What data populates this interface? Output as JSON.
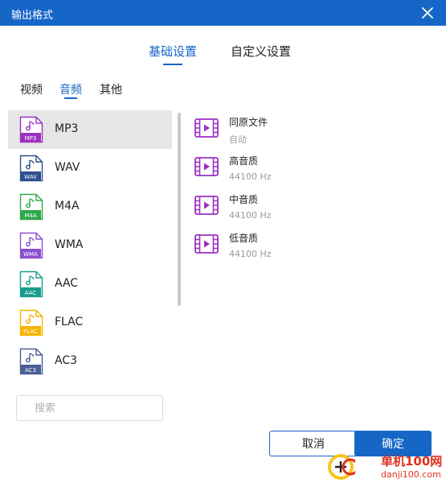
{
  "window": {
    "title": "输出格式"
  },
  "top_tabs": [
    {
      "label": "基础设置",
      "active": true
    },
    {
      "label": "自定义设置",
      "active": false
    }
  ],
  "sub_tabs": [
    {
      "label": "视频",
      "active": false
    },
    {
      "label": "音频",
      "active": true
    },
    {
      "label": "其他",
      "active": false
    }
  ],
  "formats": [
    {
      "label": "MP3",
      "tag": "MP3",
      "color": "#9b30c0",
      "selected": true
    },
    {
      "label": "WAV",
      "tag": "WAV",
      "color": "#2f4f8f",
      "selected": false
    },
    {
      "label": "M4A",
      "tag": "M4A",
      "color": "#2fa84a",
      "selected": false
    },
    {
      "label": "WMA",
      "tag": "WMA",
      "color": "#8a4fd0",
      "selected": false
    },
    {
      "label": "AAC",
      "tag": "AAC",
      "color": "#1a9c8c",
      "selected": false
    },
    {
      "label": "FLAC",
      "tag": "FLAC",
      "color": "#f5b400",
      "selected": false
    },
    {
      "label": "AC3",
      "tag": "AC3",
      "color": "#4a5f95",
      "selected": false
    }
  ],
  "qualities": [
    {
      "name": "同原文件",
      "detail": "自动"
    },
    {
      "name": "高音质",
      "detail": "44100 Hz"
    },
    {
      "name": "中音质",
      "detail": "44100 Hz"
    },
    {
      "name": "低音质",
      "detail": "44100 Hz"
    }
  ],
  "search": {
    "placeholder": "搜索",
    "value": ""
  },
  "buttons": {
    "cancel": "取消",
    "ok": "确定"
  },
  "watermark": {
    "line1": "单机100网",
    "line2": "danji100.com"
  },
  "colors": {
    "accent": "#1666c7",
    "media_icon": "#9b30c0",
    "selected_bg": "#e6e6e6",
    "watermark": "#e0301e"
  },
  "icons": {
    "close": "close-icon",
    "media": "film-play-icon",
    "file": "audio-file-icon"
  }
}
